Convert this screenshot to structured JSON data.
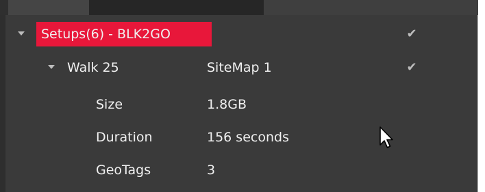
{
  "tree": {
    "root": {
      "label": "Setups(6) - BLK2GO",
      "checked_glyph": "✔"
    },
    "child": {
      "label": "Walk 25",
      "value": "SiteMap 1",
      "checked_glyph": "✔"
    },
    "properties": [
      {
        "key": "Size",
        "value": "1.8GB"
      },
      {
        "key": "Duration",
        "value": "156 seconds"
      },
      {
        "key": "GeoTags",
        "value": "3"
      }
    ]
  },
  "colors": {
    "background": "#3a3a3a",
    "highlight": "#e8173a",
    "text": "#f0f0f0",
    "check": "#bcbcbc"
  },
  "icons": {
    "expand": "chevron-down-icon",
    "check": "checkmark-icon",
    "cursor": "mouse-pointer-icon"
  }
}
